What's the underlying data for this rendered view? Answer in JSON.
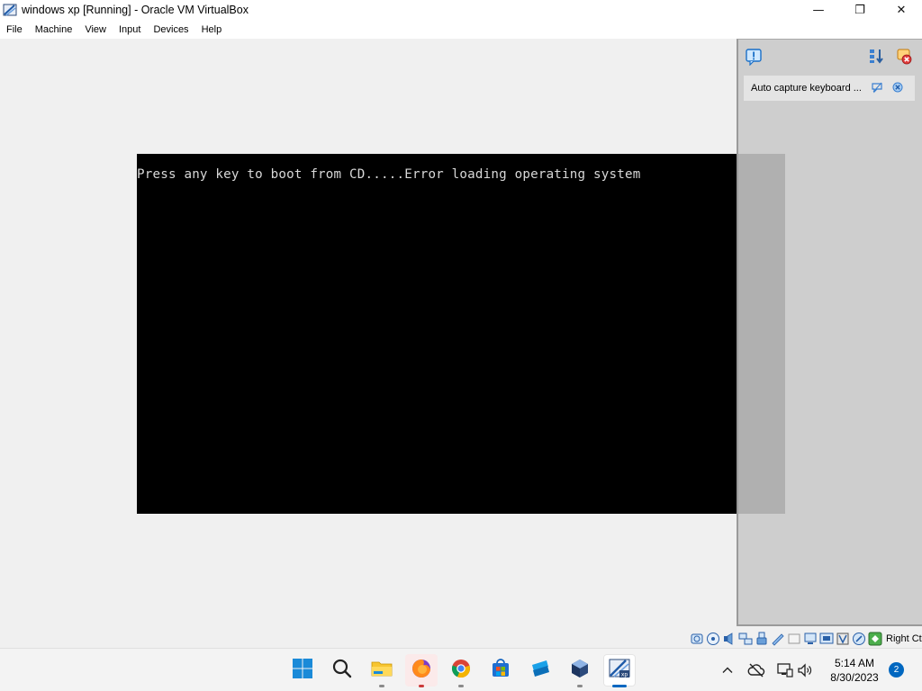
{
  "window": {
    "title": "windows xp [Running] - Oracle VM VirtualBox",
    "minimize_glyph": "—",
    "maximize_glyph": "❐",
    "close_glyph": "✕"
  },
  "menu": [
    {
      "label": "File"
    },
    {
      "label": "Machine"
    },
    {
      "label": "View"
    },
    {
      "label": "Input"
    },
    {
      "label": "Devices"
    },
    {
      "label": "Help"
    }
  ],
  "vm_screen": {
    "text": "Press any key to boot from CD.....Error loading operating system",
    "background": "#000000",
    "text_color": "#d8d8d8"
  },
  "notification_panel": {
    "message": "Auto capture keyboard ...",
    "icons": [
      "notification-center-icon",
      "toggle-order-icon",
      "delete-all-icon",
      "toggle-do-not-disturb-icon",
      "dismiss-icon"
    ]
  },
  "statusbar": {
    "host_key": "Right Ctrl",
    "icons": [
      "hard-disk-icon",
      "optical-drive-icon",
      "audio-icon",
      "network-icon",
      "usb-icon",
      "shared-folders-icon",
      "display-icon",
      "recording-icon",
      "virtualization-icon",
      "cpu-icon",
      "mouse-integration-icon",
      "keyboard-icon"
    ]
  },
  "taskbar": {
    "apps": [
      "start-icon",
      "search-icon",
      "file-explorer-icon",
      "firefox-icon",
      "chrome-icon",
      "microsoft-store-icon",
      "roblox-studio-icon",
      "virtualbox-icon",
      "vm-window-icon"
    ],
    "tray_icons": [
      "show-hidden-icons-icon",
      "cloud-off-icon",
      "network-icon",
      "volume-icon"
    ],
    "time": "5:14 AM",
    "date": "8/30/2023",
    "notification_count": "2",
    "accent": "#0067c0"
  }
}
